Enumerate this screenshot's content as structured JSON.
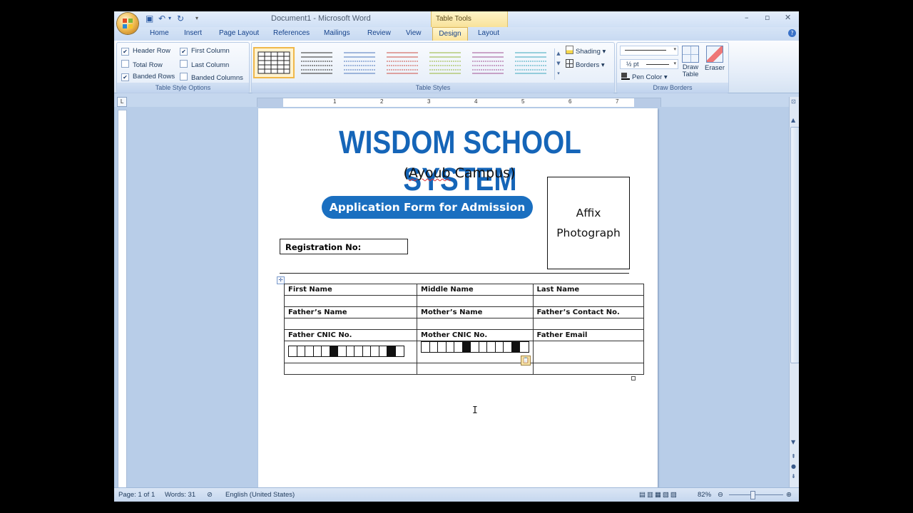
{
  "window": {
    "title": "Document1 - Microsoft Word",
    "context_group": "Table Tools",
    "minimize": "–",
    "restore": "▫",
    "close": "✕"
  },
  "tabs": [
    "Home",
    "Insert",
    "Page Layout",
    "References",
    "Mailings",
    "Review",
    "View",
    "Design",
    "Layout"
  ],
  "active_tab": "Design",
  "table_style_options": {
    "label": "Table Style Options",
    "items": [
      {
        "label": "Header Row",
        "checked": true
      },
      {
        "label": "Total Row",
        "checked": false
      },
      {
        "label": "Banded Rows",
        "checked": true
      },
      {
        "label": "First Column",
        "checked": true
      },
      {
        "label": "Last Column",
        "checked": false
      },
      {
        "label": "Banded Columns",
        "checked": false
      }
    ]
  },
  "table_styles": {
    "label": "Table Styles",
    "shading": "Shading",
    "borders": "Borders",
    "swatch_colors": [
      "#222222",
      "#555555",
      "#6d8fc8",
      "#d4706a",
      "#a9c25e",
      "#5fb6c9"
    ]
  },
  "draw_borders": {
    "label": "Draw Borders",
    "pen_weight": "½ pt",
    "pen_color": "Pen Color",
    "draw_table": "Draw Table",
    "eraser": "Eraser"
  },
  "ruler": {
    "numbers": [
      "1",
      "2",
      "3",
      "4",
      "5",
      "6",
      "7"
    ]
  },
  "document": {
    "school_name": "WISDOM SCHOOL SYSTEM",
    "campus_open": "(",
    "campus_word": "Ayoub",
    "campus_rest": " Campus)",
    "form_title": "Application Form for Admission",
    "photo_line1": "Affix",
    "photo_line2": "Photograph",
    "registration_label": "Registration No:",
    "table": {
      "row1": [
        "First Name",
        "Middle Name",
        "Last Name"
      ],
      "row2": [
        "Father’s Name",
        "Mother’s Name",
        "Father’s Contact  No."
      ],
      "row3": [
        "Father CNIC No.",
        "Mother CNIC No.",
        "Father Email"
      ]
    },
    "brand_color": "#1565b8"
  },
  "status": {
    "page": "Page: 1 of 1",
    "words": "Words: 31",
    "language": "English (United States)",
    "zoom": "82%"
  }
}
